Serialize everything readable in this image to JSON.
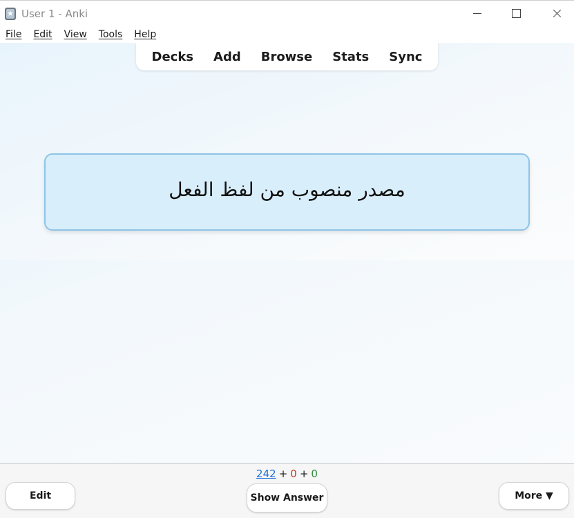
{
  "window": {
    "title": "User 1 - Anki",
    "icon": "anki-icon",
    "controls": [
      "minimize-icon",
      "maximize-icon",
      "close-icon"
    ]
  },
  "menubar": {
    "items": [
      {
        "label": "File"
      },
      {
        "label": "Edit"
      },
      {
        "label": "View"
      },
      {
        "label": "Tools"
      },
      {
        "label": "Help"
      }
    ]
  },
  "toolbar": {
    "items": [
      {
        "label": "Decks"
      },
      {
        "label": "Add"
      },
      {
        "label": "Browse"
      },
      {
        "label": "Stats"
      },
      {
        "label": "Sync"
      }
    ]
  },
  "card": {
    "front_text": "مصدر منصوب من لفظ الفعل"
  },
  "bottom": {
    "counts": {
      "new": "242",
      "learn": "0",
      "review": "0",
      "separator": "+"
    },
    "edit_label": "Edit",
    "show_answer_label": "Show Answer",
    "more_label": "More ▼"
  },
  "colors": {
    "count_new": "#1e6fd9",
    "count_learn": "#c0392b",
    "count_review": "#2e8b3a",
    "card_background": "#d9eefb",
    "card_border": "#8ec4e6"
  }
}
